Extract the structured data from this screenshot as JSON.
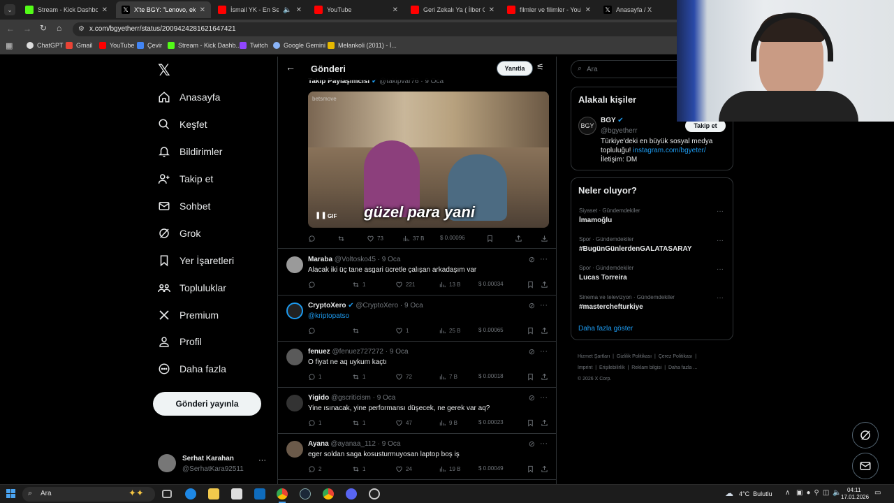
{
  "browser": {
    "tabs": [
      {
        "label": "Stream - Kick Dashboard",
        "active": false
      },
      {
        "label": "X'te BGY: \"Lenovo, ekrani",
        "active": true
      },
      {
        "label": "İsmail YK - En Sevdiğ",
        "active": false
      },
      {
        "label": "YouTube",
        "active": false
      },
      {
        "label": "Geri Zekalı Ya ( İlber Ortay",
        "active": false
      },
      {
        "label": "filmler ve filimler - YouTub",
        "active": false
      },
      {
        "label": "Anasayfa / X",
        "active": false
      }
    ],
    "url": "x.com/bgyetherr/status/2009424281621647421",
    "bookmarks": [
      "ChatGPT",
      "Gmail",
      "YouTube",
      "Çevir",
      "Stream - Kick Dashb...",
      "Twitch",
      "Google Gemini",
      "Melankoli (2011) - İ..."
    ]
  },
  "nav": {
    "items": [
      "Anasayfa",
      "Keşfet",
      "Bildirimler",
      "Takip et",
      "Sohbet",
      "Grok",
      "Yer İşaretleri",
      "Topluluklar",
      "Premium",
      "Profil",
      "Daha fazla"
    ],
    "post_button": "Gönderi yayınla",
    "user": {
      "name": "Serhat Karahan",
      "handle": "@SerhatKara92511"
    }
  },
  "header": {
    "title": "Gönderi",
    "reply_button": "Yanıtla"
  },
  "top_tweet": {
    "partial_name": "Takip Paylaşımcısı",
    "partial_handle": "@takipvar76",
    "partial_date": "9 Oca",
    "gif_caption": "güzel para yani",
    "gif_badge": "GIF",
    "watermark": "betsmove",
    "stats": {
      "likes": "73",
      "views": "37 B",
      "earn": "$ 0.00096"
    }
  },
  "replies": [
    {
      "name": "Maraba",
      "handle": "@Voltosko45",
      "date": "9 Oca",
      "text": "Alacak iki üç tane asgari ücretle çalışan arkadaşım var",
      "replies": "",
      "retweets": "1",
      "likes": "221",
      "views": "13 B",
      "earn": "$ 0.00034",
      "verified": false,
      "link": false
    },
    {
      "name": "CryptoXero",
      "handle": "@CryptoXero",
      "date": "9 Oca",
      "text": "@kriptopatso",
      "replies": "",
      "retweets": "",
      "likes": "1",
      "views": "25 B",
      "earn": "$ 0.00065",
      "verified": true,
      "link": true
    },
    {
      "name": "fenuez",
      "handle": "@fenuez727272",
      "date": "9 Oca",
      "text": "O fiyat ne aq uykum kaçtı",
      "replies": "1",
      "retweets": "1",
      "likes": "72",
      "views": "7 B",
      "earn": "$ 0.00018",
      "verified": false,
      "link": false
    },
    {
      "name": "Yigido",
      "handle": "@gscriticism",
      "date": "9 Oca",
      "text": "Yine ısınacak, yine performansı düşecek, ne gerek var aq?",
      "replies": "1",
      "retweets": "1",
      "likes": "47",
      "views": "9 B",
      "earn": "$ 0.00023",
      "verified": false,
      "link": false
    },
    {
      "name": "Ayana",
      "handle": "@ayanaa_112",
      "date": "9 Oca",
      "text": "eger soldan saga kosusturmuyosan laptop boş iş",
      "replies": "2",
      "retweets": "1",
      "likes": "24",
      "views": "19 B",
      "earn": "$ 0.00049",
      "verified": false,
      "link": false
    }
  ],
  "right": {
    "search_placeholder": "Ara",
    "related_title": "Alakalı kişiler",
    "related": {
      "name": "BGY",
      "handle": "@bgyetherr",
      "follow": "Takip et",
      "bio_line1": "Türkiye'deki en büyük sosyal medya",
      "bio_line2a": "topluluğu! ",
      "bio_link": "instagram.com/bgyeter/",
      "bio_line3": "İletişim: DM"
    },
    "trends_title": "Neler oluyor?",
    "trends": [
      {
        "cat": "Siyaset · Gündemdekiler",
        "topic": "İmamoğlu"
      },
      {
        "cat": "Spor · Gündemdekiler",
        "topic": "#BugünGünlerdenGALATASARAY"
      },
      {
        "cat": "Spor · Gündemdekiler",
        "topic": "Lucas Torreira"
      },
      {
        "cat": "Sinema ve televizyon · Gündemdekiler",
        "topic": "#masterchefturkiye"
      }
    ],
    "show_more": "Daha fazla göster",
    "footer1": [
      "Hizmet Şartları",
      "Gizlilik Politikası",
      "Çerez Politikası"
    ],
    "footer2": [
      "Imprint",
      "Erişilebilirlik",
      "Reklam bilgisi",
      "Daha fazla ..."
    ],
    "copyright": "© 2026 X Corp."
  },
  "taskbar": {
    "search": "Ara",
    "weather": "4°C  Bulutlu",
    "time": "04:11",
    "date": "17.01.2026"
  },
  "colors": {
    "accent": "#1d9bf0",
    "kick": "#53fc18",
    "youtube": "#ff0000"
  }
}
